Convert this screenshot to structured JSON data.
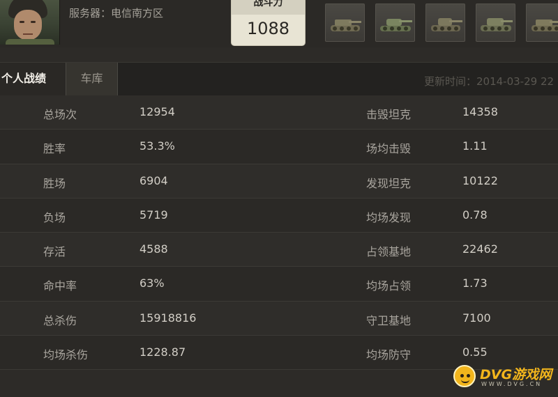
{
  "header": {
    "server_text": "服务器：电信南方区",
    "rating_label": "战斗力",
    "rating_value": "1088",
    "tanks": [
      "tank-1",
      "tank-2",
      "tank-3",
      "tank-4",
      "tank-5"
    ]
  },
  "tabs": {
    "active": "个人战绩",
    "garage": "车库"
  },
  "updated_text": "更新时间：2014-03-29 22",
  "stats": [
    {
      "left_label": "总场次",
      "left_value": "12954",
      "right_label": "击毁坦克",
      "right_value": "14358"
    },
    {
      "left_label": "胜率",
      "left_value": "53.3%",
      "right_label": "场均击毁",
      "right_value": "1.11"
    },
    {
      "left_label": "胜场",
      "left_value": "6904",
      "right_label": "发现坦克",
      "right_value": "10122"
    },
    {
      "left_label": "负场",
      "left_value": "5719",
      "right_label": "均场发现",
      "right_value": "0.78"
    },
    {
      "left_label": "存活",
      "left_value": "4588",
      "right_label": "占领基地",
      "right_value": "22462"
    },
    {
      "left_label": "命中率",
      "left_value": "63%",
      "right_label": "均场占领",
      "right_value": "1.73"
    },
    {
      "left_label": "总杀伤",
      "left_value": "15918816",
      "right_label": "守卫基地",
      "right_value": "7100"
    },
    {
      "left_label": "均场杀伤",
      "left_value": "1228.87",
      "right_label": "均场防守",
      "right_value": "0.55"
    }
  ],
  "watermark": {
    "title": "DVG游戏网",
    "sub": "WWW.DVG.CN"
  },
  "colors": {
    "background": "#2d2b28",
    "rating_box": "#e8e4d4",
    "watermark_accent": "#f2b51c"
  }
}
